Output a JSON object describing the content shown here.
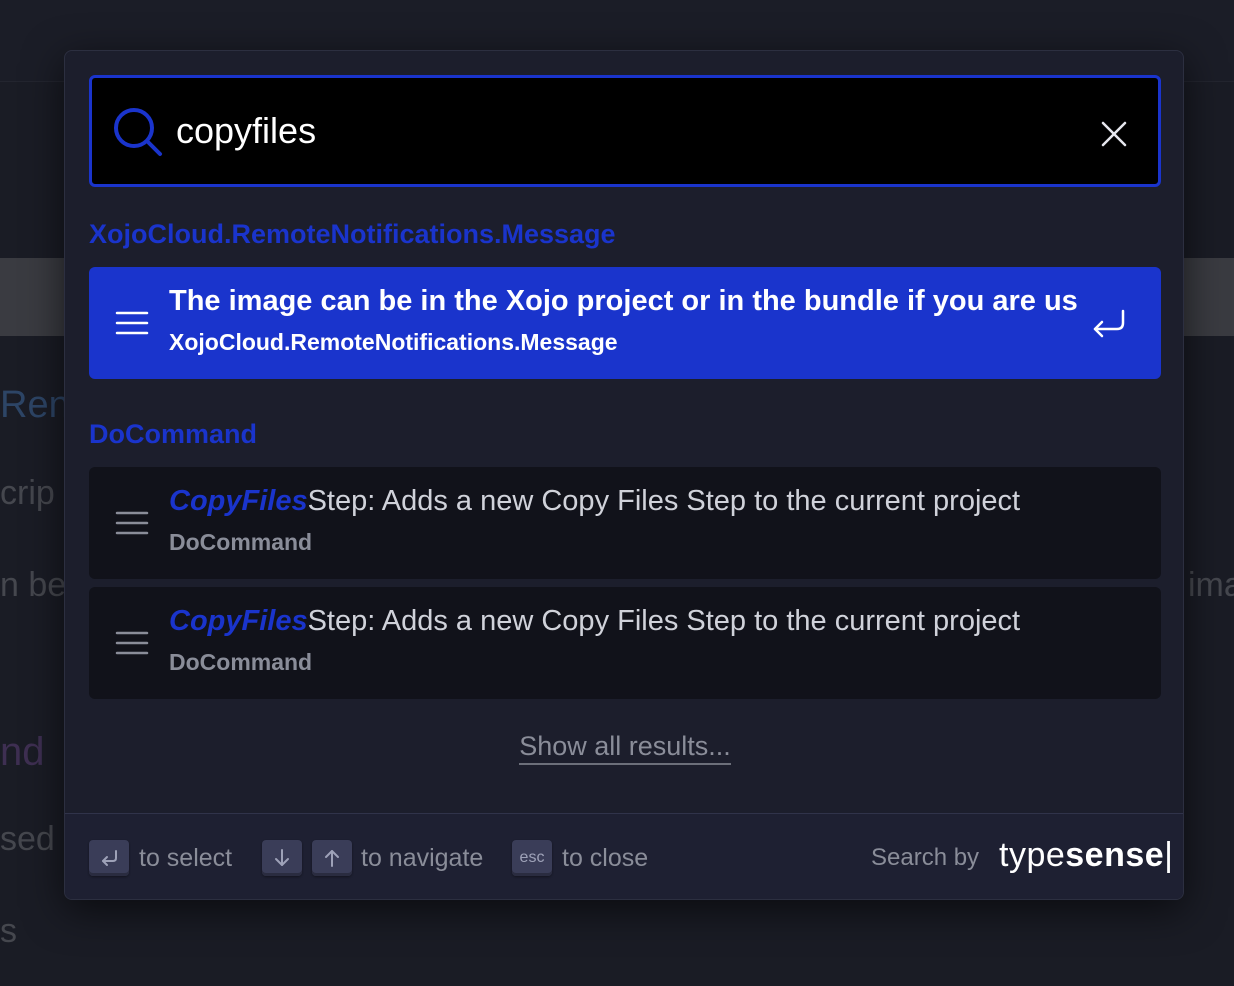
{
  "background": {
    "heading": "Ren",
    "line1": "crip",
    "line2_left": "n be i",
    "line2_right": "ima",
    "heading2": "nd",
    "line3": "sed",
    "line4": "s"
  },
  "search": {
    "query": "copyfiles",
    "clear_icon": "close-icon",
    "search_icon": "search-icon"
  },
  "groups": [
    {
      "title": "XojoCloud.RemoteNotifications.Message",
      "hits": [
        {
          "highlight": "",
          "title": "The image can be in the Xojo project or in the bundle if you are us",
          "path": "XojoCloud.RemoteNotifications.Message",
          "selected": true
        }
      ]
    },
    {
      "title": "DoCommand",
      "hits": [
        {
          "highlight": "CopyFiles",
          "title": "Step: Adds a new Copy Files Step to the current project",
          "path": "DoCommand",
          "selected": false
        },
        {
          "highlight": "CopyFiles",
          "title": "Step: Adds a new Copy Files Step to the current project",
          "path": "DoCommand",
          "selected": false
        }
      ]
    }
  ],
  "show_all": "Show all results...",
  "footer": {
    "select_label": "to select",
    "navigate_label": "to navigate",
    "esc_key": "esc",
    "close_label": "to close",
    "search_by": "Search by",
    "brand_light": "type",
    "brand_bold": "sense"
  },
  "colors": {
    "accent": "#1a34cc",
    "modal_bg": "#1c1e2c",
    "hit_bg": "#11121a"
  }
}
